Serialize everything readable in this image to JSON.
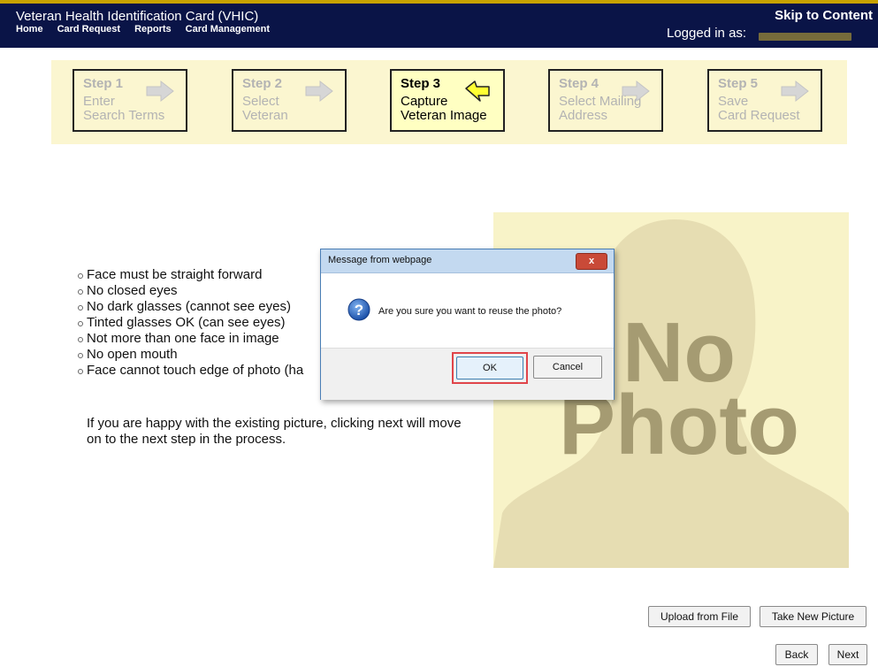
{
  "header": {
    "app_title": "Veteran Health Identification Card (VHIC)",
    "skip_link": "Skip to Content",
    "nav": [
      "Home",
      "Card Request",
      "Reports",
      "Card Management"
    ],
    "logged_in_label": "Logged in as:"
  },
  "steps": [
    {
      "number": "Step 1",
      "desc": "Enter\nSearch Terms",
      "active": false
    },
    {
      "number": "Step 2",
      "desc": "Select\nVeteran",
      "active": false
    },
    {
      "number": "Step 3",
      "desc": "Capture\nVeteran Image",
      "active": true
    },
    {
      "number": "Step 4",
      "desc": "Select Mailing\nAddress",
      "active": false
    },
    {
      "number": "Step 5",
      "desc": "Save\nCard Request",
      "active": false
    }
  ],
  "rules": [
    "Face must be straight forward",
    "No closed eyes",
    "No dark glasses (cannot see eyes)",
    "Tinted glasses OK (can see eyes)",
    "Not more than one face in image",
    "No open mouth",
    "Face cannot touch edge of photo (ha"
  ],
  "note": "If you are happy with the existing picture, clicking next will move on to the next step in the process.",
  "photo": {
    "line1": "No",
    "line2": "Photo"
  },
  "buttons": {
    "upload": "Upload from File",
    "take_picture": "Take New Picture",
    "back": "Back",
    "next": "Next"
  },
  "dialog": {
    "title": "Message from webpage",
    "close": "x",
    "message": "Are you sure you want to reuse the photo?",
    "ok": "OK",
    "cancel": "Cancel"
  },
  "colors": {
    "header_bg": "#0a1447",
    "step_bar_bg": "#fbf6d0",
    "active_step_bg": "#ffffc2",
    "highlight": "#e0454a"
  }
}
